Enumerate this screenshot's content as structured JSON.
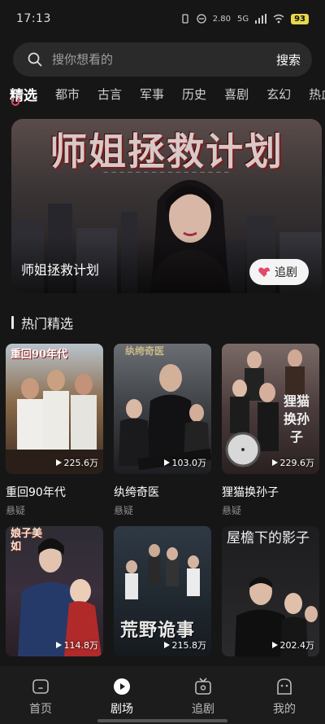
{
  "status_bar": {
    "time": "17:13",
    "net_speed": "2.80",
    "signal": "5G",
    "battery": "93"
  },
  "search": {
    "placeholder": "搜你想看的",
    "button_label": "搜索"
  },
  "tabs": [
    {
      "label": "精选",
      "active": true
    },
    {
      "label": "都市",
      "active": false
    },
    {
      "label": "古言",
      "active": false
    },
    {
      "label": "军事",
      "active": false
    },
    {
      "label": "历史",
      "active": false
    },
    {
      "label": "喜剧",
      "active": false
    },
    {
      "label": "玄幻",
      "active": false
    },
    {
      "label": "热血",
      "active": false
    }
  ],
  "banner": {
    "poster_heading": "师姐拯救计划",
    "title": "师姐拯救计划",
    "follow_label": "追剧"
  },
  "section": {
    "title": "热门精选"
  },
  "dramas": [
    {
      "title": "重回90年代",
      "genre": "悬疑",
      "plays": "225.6万",
      "poster_text": "重回90年代"
    },
    {
      "title": "纨绔奇医",
      "genre": "悬疑",
      "plays": "103.0万",
      "poster_text": "纨绔奇医"
    },
    {
      "title": "狸猫换孙子",
      "genre": "悬疑",
      "plays": "229.6万",
      "poster_text": "狸猫换孙子"
    },
    {
      "title": "",
      "genre": "",
      "plays": "114.8万",
      "poster_text": "娘子美如"
    },
    {
      "title": "",
      "genre": "",
      "plays": "215.8万",
      "poster_text": "荒野诡事"
    },
    {
      "title": "",
      "genre": "",
      "plays": "202.4万",
      "poster_text": "屋檐下的影子"
    }
  ],
  "nav": [
    {
      "label": "首页",
      "icon": "home-icon",
      "active": false
    },
    {
      "label": "剧场",
      "icon": "theater-icon",
      "active": true
    },
    {
      "label": "追剧",
      "icon": "tv-icon",
      "active": false
    },
    {
      "label": "我的",
      "icon": "profile-icon",
      "active": false
    }
  ],
  "colors": {
    "accent": "#e04a6a",
    "background": "#161616",
    "battery": "#e8d84a"
  }
}
